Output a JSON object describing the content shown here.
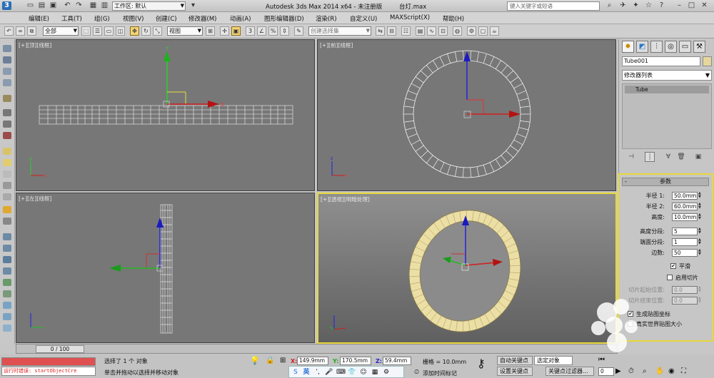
{
  "titlebar": {
    "workspace_label": "工作区: 默认",
    "app_title": "Autodesk 3ds Max  2014 x64  - 未注册版",
    "file_name": "台灯.max",
    "search_placeholder": "键入关键字或短语"
  },
  "menu": [
    "编辑(E)",
    "工具(T)",
    "组(G)",
    "视图(V)",
    "创建(C)",
    "修改器(M)",
    "动画(A)",
    "图形编辑器(D)",
    "渲染(R)",
    "自定义(U)",
    "MAXScript(X)",
    "帮助(H)"
  ],
  "toolbar": {
    "filter_value": "全部",
    "refcoord_value": "视图",
    "selset_placeholder": "创建选择集"
  },
  "viewports": {
    "top": "[+][顶][线框]",
    "front": "[+][前][线框]",
    "left": "[+][左][线框]",
    "persp": "[+][透视][明暗处理]"
  },
  "command_panel": {
    "object_name": "Tube001",
    "modifier_list": "修改器列表",
    "stack_item": "Tube",
    "object_color": "#e6d69b"
  },
  "params": {
    "title": "参数",
    "radius1_label": "半径 1:",
    "radius1": "50.0mm",
    "radius2_label": "半径 2:",
    "radius2": "60.0mm",
    "height_label": "高度:",
    "height": "10.0mm",
    "height_segs_label": "高度分段:",
    "height_segs": "5",
    "cap_segs_label": "端面分段:",
    "cap_segs": "1",
    "sides_label": "边数:",
    "sides": "50",
    "smooth_label": "平滑",
    "slice_on_label": "启用切片",
    "slice_from_label": "切片起始位置:",
    "slice_from": "0.0",
    "slice_to_label": "切片结束位置:",
    "slice_to": "0.0",
    "gen_map_label": "生成贴图坐标",
    "real_world_label": "真实世界贴图大小"
  },
  "bottom": {
    "time_slider": "0 / 100",
    "runtime_error_label": "运行时错误",
    "runtime_error_text": "运行时错误: startObjectCre",
    "status_selected": "选择了 1 个 对象",
    "status_prompt": "单击并拖动以选择并移动对象",
    "x_label": "X:",
    "x_value": "149.9mm",
    "y_label": "Y:",
    "y_value": "170.5mm",
    "z_label": "Z:",
    "z_value": "59.4mm",
    "grid_label": "栅格 = 10.0mm",
    "autokey": "自动关键点",
    "setkey": "设置关键点",
    "selected_dropdown": "选定对象",
    "key_filters": "关键点过滤器...",
    "add_time_tag": "添加时间标记",
    "frame_value": "0"
  },
  "ime": {
    "lang": "英"
  }
}
